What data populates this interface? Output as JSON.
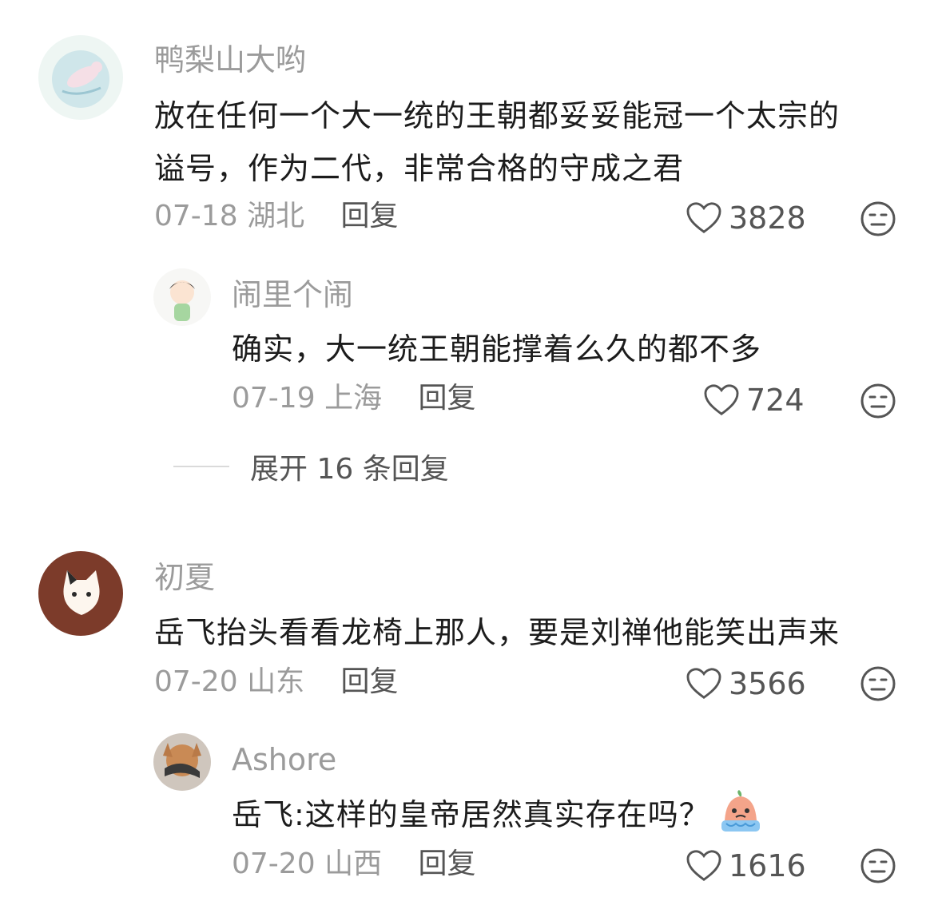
{
  "comments": [
    {
      "username": "鸭梨山大哟",
      "lines": [
        "放在任何一个大一统的王朝都妥妥能冠一个太宗的",
        "谥号，作为二代，非常合格的守成之君"
      ],
      "date": "07-18",
      "location": "湖北",
      "reply_label": "回复",
      "likes": "3828",
      "replies": [
        {
          "username": "闹里个闹",
          "lines": [
            "确实，大一统王朝能撑着么久的都不多"
          ],
          "date": "07-19",
          "location": "上海",
          "reply_label": "回复",
          "likes": "724"
        }
      ],
      "expand_label": "展开 16 条回复"
    },
    {
      "username": "初夏",
      "lines": [
        "岳飞抬头看看龙椅上那人，要是刘禅他能笑出声来"
      ],
      "date": "07-20",
      "location": "山东",
      "reply_label": "回复",
      "likes": "3566",
      "replies": [
        {
          "username": "Ashore",
          "lines": [
            "岳飞:这样的皇帝居然真实存在吗？"
          ],
          "date": "07-20",
          "location": "山西",
          "reply_label": "回复",
          "likes": "1616",
          "emoji": "crying-peach-emoji"
        }
      ]
    }
  ],
  "icons": {
    "like": "heart-outline-icon",
    "dislike": "meh-face-icon"
  },
  "colors": {
    "text": "#1c1c1c",
    "meta": "#9b9b9b",
    "action": "#555555"
  }
}
